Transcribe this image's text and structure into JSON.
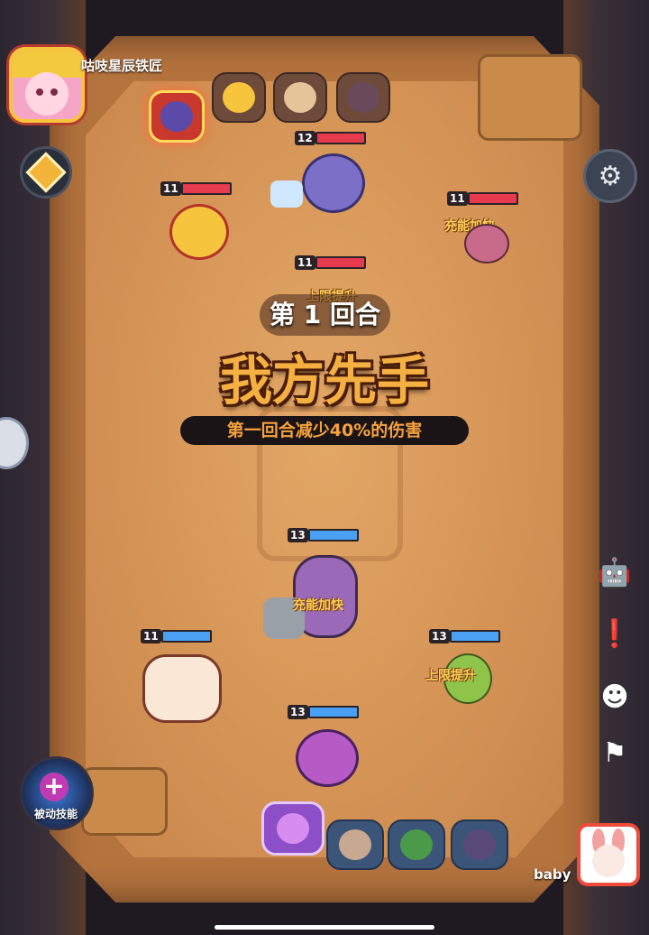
{
  "player": {
    "name": "咕吱星辰铁匠"
  },
  "opponent": {
    "name": "baby"
  },
  "round": {
    "label": "第 1 回合",
    "headline": "我方先手",
    "subtitle": "第一回合减少40%的伤害"
  },
  "passive_skill": {
    "label": "被动技能"
  },
  "turn_order_enemy": [
    {
      "icon": "purple-cat-icon",
      "active": true
    },
    {
      "icon": "chicken-icon",
      "active": false
    },
    {
      "icon": "bulldog-icon",
      "active": false
    },
    {
      "icon": "bandit-icon",
      "active": false
    }
  ],
  "turn_order_ally": [
    {
      "icon": "witch-cat-icon",
      "active": true
    },
    {
      "icon": "pirate-icon",
      "active": false
    },
    {
      "icon": "frog-icon",
      "active": false
    },
    {
      "icon": "gorilla-icon",
      "active": false
    }
  ],
  "enemies": [
    {
      "name": "ice-cat",
      "level": "12",
      "hp": 1.0
    },
    {
      "name": "chicken",
      "level": "11",
      "hp": 1.0
    },
    {
      "name": "bandit-girl",
      "level": "11",
      "hp": 1.0,
      "buff": "充能加快"
    },
    {
      "name": "bulldog",
      "level": "11",
      "hp": 1.0,
      "buff": "上限提升"
    }
  ],
  "allies": [
    {
      "name": "gorilla",
      "level": "13",
      "hp": 1.0,
      "buff": "充能加快"
    },
    {
      "name": "old-smith",
      "level": "11",
      "hp": 1.0
    },
    {
      "name": "frog-kid",
      "level": "13",
      "hp": 1.0,
      "buff": "上限提升"
    },
    {
      "name": "witch-cat",
      "level": "13",
      "hp": 1.0
    }
  ],
  "side_buttons": [
    "robot-icon",
    "alert-icon",
    "emote-icon",
    "flag-icon"
  ],
  "colors": {
    "enemy_hp": "#e63b4e",
    "ally_hp": "#4aa0f2",
    "headline": "#f5b042",
    "subtitle": "#f6a23c"
  }
}
